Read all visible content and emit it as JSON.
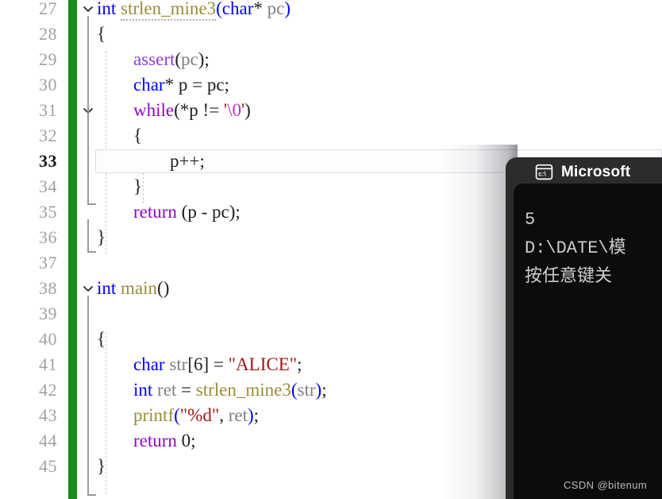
{
  "editor": {
    "first_line_number": 27,
    "line_height": 32,
    "change_bar_color": "#1a8a1a",
    "current_line": 33,
    "lines": [
      {
        "n": 27,
        "fold": "chevron-down",
        "text": "int strlen_mine3(char* pc)"
      },
      {
        "n": 28,
        "fold": "",
        "text": "{"
      },
      {
        "n": 29,
        "fold": "",
        "text": "    assert(pc);"
      },
      {
        "n": 30,
        "fold": "",
        "text": "    char* p = pc;"
      },
      {
        "n": 31,
        "fold": "chevron-down",
        "text": "    while(*p != '\\0')"
      },
      {
        "n": 32,
        "fold": "",
        "text": "    {"
      },
      {
        "n": 33,
        "fold": "",
        "text": "        p++;"
      },
      {
        "n": 34,
        "fold": "",
        "text": "    }"
      },
      {
        "n": 35,
        "fold": "",
        "text": "    return (p - pc);"
      },
      {
        "n": 36,
        "fold": "",
        "text": "}"
      },
      {
        "n": 37,
        "fold": "",
        "text": ""
      },
      {
        "n": 38,
        "fold": "chevron-down",
        "text": "int main()"
      },
      {
        "n": 39,
        "fold": "",
        "text": ""
      },
      {
        "n": 40,
        "fold": "",
        "text": "{"
      },
      {
        "n": 41,
        "fold": "",
        "text": "    char str[6] = \"ALICE\";"
      },
      {
        "n": 42,
        "fold": "",
        "text": "    int ret = strlen_mine3(str);"
      },
      {
        "n": 43,
        "fold": "",
        "text": "    printf(\"%d\", ret);"
      },
      {
        "n": 44,
        "fold": "",
        "text": "    return 0;"
      },
      {
        "n": 45,
        "fold": "",
        "text": "}"
      }
    ],
    "tokens": {
      "l27": [
        {
          "t": "int",
          "c": "t-kw"
        },
        {
          "t": " ",
          "c": "t-pun"
        },
        {
          "t": "strlen_mine3",
          "c": "t-fn squiggle"
        },
        {
          "t": "(",
          "c": "t-kw"
        },
        {
          "t": "char",
          "c": "t-kw"
        },
        {
          "t": "*",
          "c": "t-pun"
        },
        {
          "t": " ",
          "c": "t-pun"
        },
        {
          "t": "pc",
          "c": "t-var"
        },
        {
          "t": ")",
          "c": "t-kw"
        }
      ],
      "l28": [
        {
          "t": "{",
          "c": "t-pun"
        }
      ],
      "l29": [
        {
          "t": "assert",
          "c": "t-macro"
        },
        {
          "t": "(",
          "c": "t-pun"
        },
        {
          "t": "pc",
          "c": "t-var"
        },
        {
          "t": ");",
          "c": "t-pun"
        }
      ],
      "l30": [
        {
          "t": "char",
          "c": "t-kw"
        },
        {
          "t": "* ",
          "c": "t-pun"
        },
        {
          "t": "p",
          "c": "t-pun"
        },
        {
          "t": " = ",
          "c": "t-pun"
        },
        {
          "t": "pc",
          "c": "t-pun"
        },
        {
          "t": ";",
          "c": "t-pun"
        }
      ],
      "l31": [
        {
          "t": "while",
          "c": "t-ctl"
        },
        {
          "t": "(*",
          "c": "t-pun"
        },
        {
          "t": "p",
          "c": "t-pun"
        },
        {
          "t": " != ",
          "c": "t-pun"
        },
        {
          "t": "'",
          "c": "t-str"
        },
        {
          "t": "\\0",
          "c": "t-esc"
        },
        {
          "t": "'",
          "c": "t-str"
        },
        {
          "t": ")",
          "c": "t-pun"
        }
      ],
      "l32": [
        {
          "t": "{",
          "c": "t-pun"
        }
      ],
      "l33": [
        {
          "t": "p++;",
          "c": "t-pun"
        }
      ],
      "l34": [
        {
          "t": "}",
          "c": "t-pun"
        }
      ],
      "l35": [
        {
          "t": "return",
          "c": "t-ctl"
        },
        {
          "t": " (",
          "c": "t-pun"
        },
        {
          "t": "p",
          "c": "t-pun"
        },
        {
          "t": " - ",
          "c": "t-pun"
        },
        {
          "t": "pc",
          "c": "t-pun"
        },
        {
          "t": ");",
          "c": "t-pun"
        }
      ],
      "l36": [
        {
          "t": "}",
          "c": "t-pun"
        }
      ],
      "l38": [
        {
          "t": "int",
          "c": "t-kw"
        },
        {
          "t": " ",
          "c": "t-pun"
        },
        {
          "t": "main",
          "c": "t-fn"
        },
        {
          "t": "()",
          "c": "t-pun"
        }
      ],
      "l40": [
        {
          "t": "{",
          "c": "t-pun"
        }
      ],
      "l41": [
        {
          "t": "char",
          "c": "t-kw"
        },
        {
          "t": " ",
          "c": "t-pun"
        },
        {
          "t": "str",
          "c": "t-var"
        },
        {
          "t": "[",
          "c": "t-pun"
        },
        {
          "t": "6",
          "c": "t-num"
        },
        {
          "t": "] = ",
          "c": "t-pun"
        },
        {
          "t": "\"ALICE\"",
          "c": "t-str"
        },
        {
          "t": ";",
          "c": "t-pun"
        }
      ],
      "l42": [
        {
          "t": "int",
          "c": "t-kw"
        },
        {
          "t": " ",
          "c": "t-pun"
        },
        {
          "t": "ret",
          "c": "t-var"
        },
        {
          "t": " = ",
          "c": "t-pun"
        },
        {
          "t": "strlen_mine3",
          "c": "t-fn"
        },
        {
          "t": "(",
          "c": "t-kw"
        },
        {
          "t": "str",
          "c": "t-var"
        },
        {
          "t": ")",
          "c": "t-kw"
        },
        {
          "t": ";",
          "c": "t-pun"
        }
      ],
      "l43": [
        {
          "t": "printf",
          "c": "t-fn"
        },
        {
          "t": "(",
          "c": "t-kw"
        },
        {
          "t": "\"%d\"",
          "c": "t-str"
        },
        {
          "t": ", ",
          "c": "t-pun"
        },
        {
          "t": "ret",
          "c": "t-var"
        },
        {
          "t": ")",
          "c": "t-kw"
        },
        {
          "t": ";",
          "c": "t-pun"
        }
      ],
      "l44": [
        {
          "t": "return",
          "c": "t-ctl"
        },
        {
          "t": " ",
          "c": "t-pun"
        },
        {
          "t": "0",
          "c": "t-num"
        },
        {
          "t": ";",
          "c": "t-pun"
        }
      ],
      "l45": [
        {
          "t": "}",
          "c": "t-pun"
        }
      ]
    }
  },
  "console": {
    "icon": "command-prompt-icon",
    "title": "Microsoft",
    "output_lines": [
      "5",
      "D:\\DATE\\模",
      "按任意键关"
    ],
    "background": "#0c0c0c",
    "titlebar_background": "#2c2c2c"
  },
  "watermark": {
    "text": "CSDN @bitenum"
  }
}
